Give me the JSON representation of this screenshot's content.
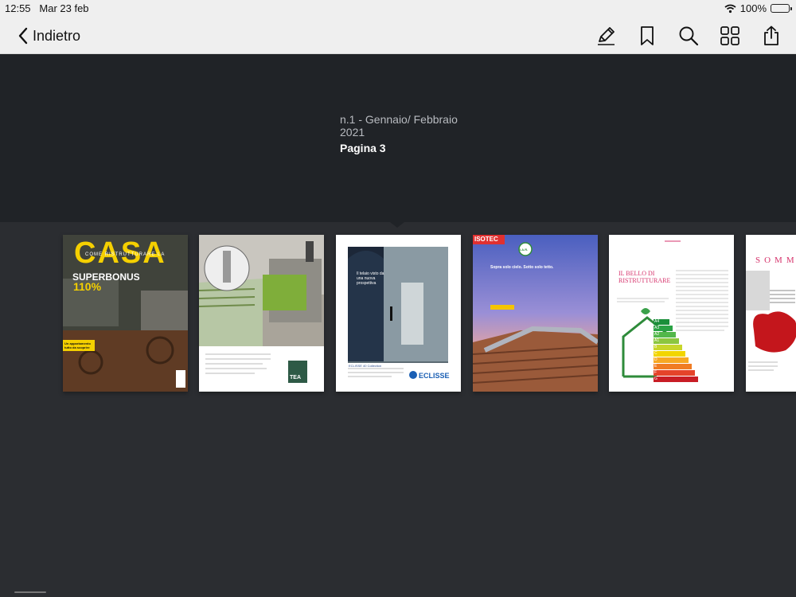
{
  "status": {
    "time": "12:55",
    "date": "Mar 23 feb",
    "battery": "100%"
  },
  "nav": {
    "back_label": "Indietro",
    "tools": [
      "pencil-icon",
      "bookmark-icon",
      "search-icon",
      "grid-icon",
      "share-icon"
    ]
  },
  "issue": {
    "title": "n.1 - Gennaio/ Febbraio 2021",
    "page": "Pagina 3"
  },
  "thumbnails": [
    {
      "title": "CASA",
      "subtitle": "COME RISTRUTTURARE LA",
      "headline": "SUPERBONUS",
      "number": "110%",
      "feature": "Un appartamento tutto da scoprire"
    },
    {
      "brand": "TEA"
    },
    {
      "caption": "Il telaio visto da una nuova prospettiva",
      "brand": "ECLISSE",
      "tagline": "ECLISSE 40 Collection"
    },
    {
      "brand": "ISOTEC",
      "headline": "Sopra solo cielo. Sotto solo tetto.",
      "badge": "I.A.R."
    },
    {
      "title": "IL BELLO DI RISTRUTTURARE",
      "energy_classes": [
        "A4",
        "A3",
        "A2",
        "A1",
        "B",
        "C",
        "D",
        "E",
        "F",
        "G"
      ]
    },
    {
      "title": "SOMMARIO"
    }
  ],
  "colors": {
    "accent": "#f5d000",
    "background": "#2b2d31",
    "header": "#202327",
    "magenta": "#d6336c"
  }
}
